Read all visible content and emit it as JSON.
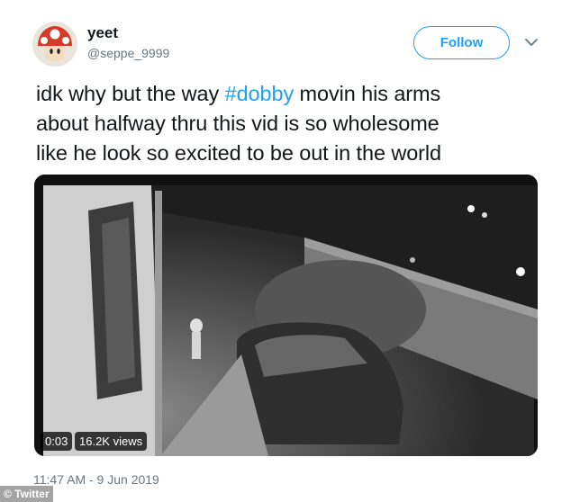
{
  "user": {
    "name": "yeet",
    "handle": "@seppe_9999",
    "avatar_icon": "mushroom-avatar-icon"
  },
  "actions": {
    "follow_label": "Follow",
    "more_icon": "chevron-down-icon"
  },
  "tweet": {
    "line1_prefix": "idk why but the way ",
    "hashtag": "#dobby",
    "line1_suffix": " movin his arms",
    "line2": "about halfway thru this vid is so wholesome",
    "line3": "like he look so excited to be out in the world"
  },
  "video": {
    "duration": "0:03",
    "views": "16.2K views"
  },
  "timestamp": "11:47 AM - 9 Jun 2019",
  "watermark": "© Twitter",
  "colors": {
    "accent": "#1da1f2",
    "text": "#14171a",
    "secondary": "#657786"
  }
}
